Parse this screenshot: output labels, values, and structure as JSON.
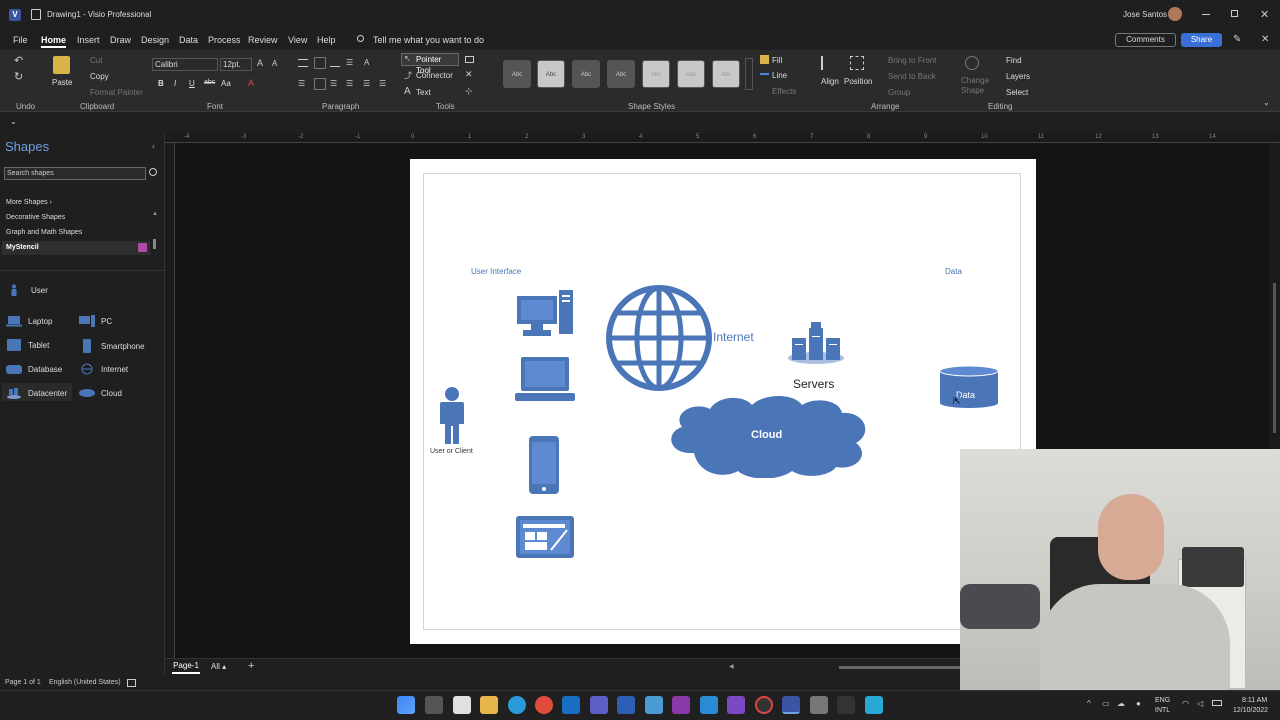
{
  "app": {
    "doc_title": "Drawing1",
    "app_name": "Visio Professional",
    "user_name": "Jose Santos"
  },
  "menu": [
    "File",
    "Home",
    "Insert",
    "Draw",
    "Design",
    "Data",
    "Process",
    "Review",
    "View",
    "Help"
  ],
  "search": {
    "placeholder": "Tell me what you want to do"
  },
  "top_right": {
    "comments": "Comments",
    "share": "Share"
  },
  "ribbon": {
    "clipboard": {
      "cut": "Cut",
      "copy": "Copy",
      "paste": "Paste",
      "format_painter": "Format Painter",
      "label": "Clipboard"
    },
    "undo_label": "Undo",
    "font": {
      "name": "Calibri",
      "size": "12pt.",
      "label": "Font"
    },
    "paragraph_label": "Paragraph",
    "tools": {
      "pointer": "Pointer Tool",
      "connector": "Connector",
      "text": "Text",
      "label": "Tools"
    },
    "shape_styles": {
      "label": "Shape Styles",
      "swatch": "Abc"
    },
    "fill": "Fill",
    "line": "Line",
    "effects": "Effects",
    "arrange": {
      "align": "Align",
      "position": "Position",
      "bring_front": "Bring to Front",
      "send_back": "Send to Back",
      "group": "Group",
      "label": "Arrange"
    },
    "editing": {
      "change_shape_1": "Change",
      "change_shape_2": "Shape",
      "find": "Find",
      "layers": "Layers",
      "select": "Select",
      "label": "Editing"
    }
  },
  "shapes_panel": {
    "title": "Shapes",
    "search_placeholder": "Search shapes",
    "categories": [
      "More Shapes",
      "Decorative Shapes",
      "Graph and Math Shapes",
      "MyStencil"
    ],
    "stencil_items": [
      {
        "label": "User",
        "icon": "user-icon"
      },
      {
        "label": "Laptop",
        "icon": "laptop-icon"
      },
      {
        "label": "PC",
        "icon": "pc-icon"
      },
      {
        "label": "Tablet",
        "icon": "tablet-icon"
      },
      {
        "label": "Smartphone",
        "icon": "smartphone-icon"
      },
      {
        "label": "Database",
        "icon": "database-icon"
      },
      {
        "label": "Internet",
        "icon": "globe-icon"
      },
      {
        "label": "Datacenter",
        "icon": "datacenter-icon"
      },
      {
        "label": "Cloud",
        "icon": "cloud-icon"
      }
    ]
  },
  "ruler_numbers": [
    "-4",
    "-3",
    "-2",
    "-1",
    "0",
    "1",
    "2",
    "3",
    "4",
    "5",
    "6",
    "7",
    "8",
    "9",
    "10",
    "11",
    "12",
    "13",
    "14"
  ],
  "diagram": {
    "user_interface": "User Interface",
    "data_header": "Data",
    "internet": "Internet",
    "servers": "Servers",
    "cloud": "Cloud",
    "user_client": "User or Client",
    "data_shape": "Data",
    "shape_color": "#4a76b8"
  },
  "page_tabs": {
    "page": "Page-1",
    "all": "All"
  },
  "status": {
    "page_of": "Page 1 of 1",
    "language": "English (United States)"
  },
  "taskbar": {
    "lang_1": "ENG",
    "lang_2": "INTL",
    "time": "8:11 AM",
    "date": "12/10/2022"
  }
}
